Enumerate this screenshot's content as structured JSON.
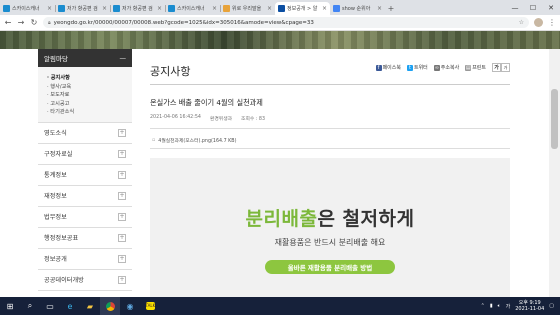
{
  "browser": {
    "tabs": [
      {
        "label": "스카이스캐너",
        "color": "#1a8ccf",
        "active": false
      },
      {
        "label": "저가 항공편 검",
        "color": "#1a8ccf",
        "active": false
      },
      {
        "label": "저가 항공편 검",
        "color": "#1a8ccf",
        "active": false
      },
      {
        "label": "스카이스캐너",
        "color": "#1a8ccf",
        "active": false
      },
      {
        "label": "위로 우리말을",
        "color": "#e8a33a",
        "active": false
      },
      {
        "label": "정보공개 > 알",
        "color": "#0b4ea2",
        "active": true
      },
      {
        "label": "show 순위아",
        "color": "#4285f4",
        "active": false
      }
    ],
    "new_tab": "+",
    "url": "yeongdo.go.kr/00000/00007/00008.web?gcode=1025&idx=305016&amode=view&cpage=33",
    "window_controls": [
      "—",
      "☐",
      "✕"
    ]
  },
  "sidebar": {
    "header": "알림마당",
    "header_icon": "—",
    "submenu": [
      {
        "label": "· 공지사항",
        "active": true
      },
      {
        "label": "· 행사/교육",
        "active": false
      },
      {
        "label": "· 보도자료",
        "active": false
      },
      {
        "label": "· 고시공고",
        "active": false
      },
      {
        "label": "· 타기관소식",
        "active": false
      }
    ],
    "items": [
      "영도소식",
      "구정자료실",
      "통계정보",
      "재정정보",
      "법무정보",
      "행정정보공표",
      "정보공개",
      "공공데이터개방"
    ]
  },
  "content": {
    "page_title": "공지사항",
    "shares": {
      "facebook": "페이스북",
      "twitter": "트위터",
      "copy": "주소복사",
      "print": "프린트"
    },
    "zoom": [
      "가",
      "가"
    ],
    "post_title": "온실가스 배출 줄이기 4월의 실천과제",
    "meta": {
      "date": "2021-04-06 16:42:54",
      "dept": "환경위생과",
      "views": "조회수 : 83"
    },
    "attachment": "4월실천과제(포스터).png(164.7 KB)",
    "promo": {
      "headline_green": "분리배출",
      "headline_dark": "은 철저하게",
      "sub": "재활용품은 반드시 분리배출 해요",
      "button": "올바른 재활용품 분리배출 방법"
    }
  },
  "taskbar": {
    "start": "⊞",
    "time": "오후 9:19",
    "date": "2021-11-04"
  }
}
